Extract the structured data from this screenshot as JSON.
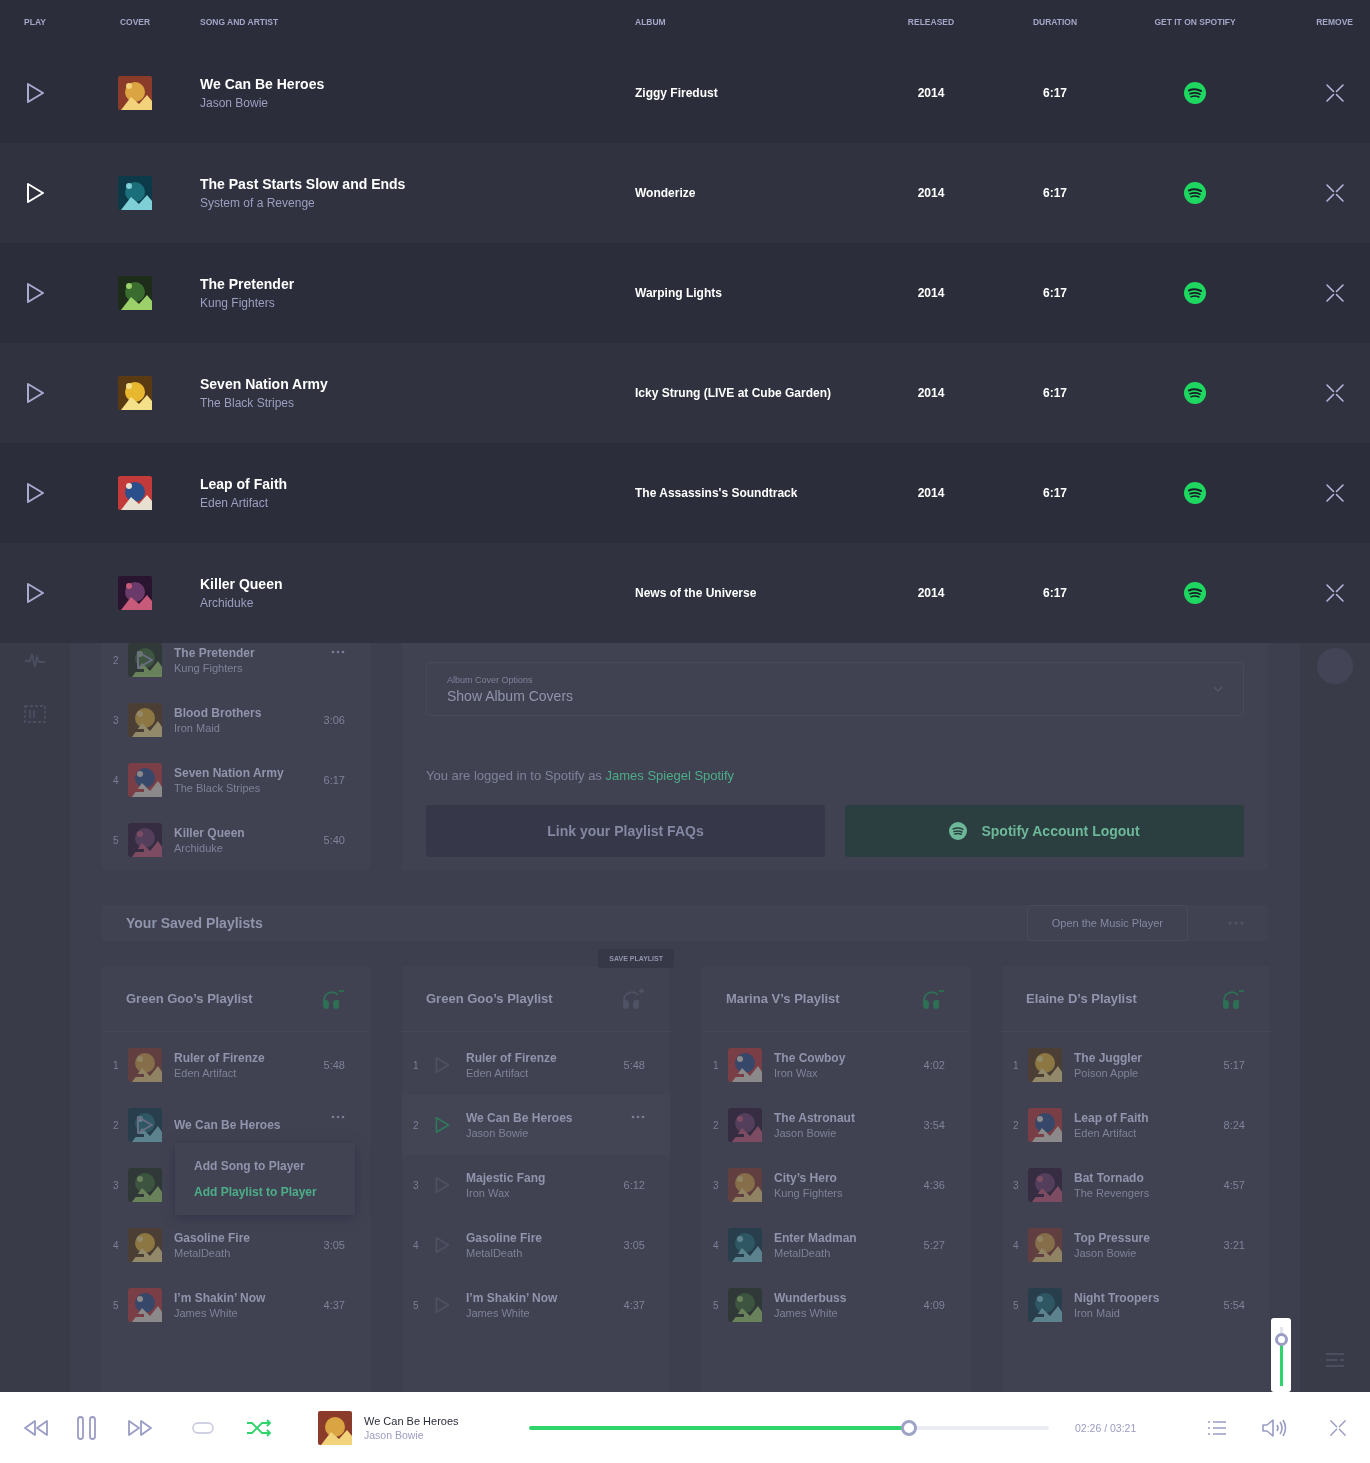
{
  "table": {
    "columns": [
      "PLAY",
      "COVER",
      "SONG AND ARTIST",
      "ALBUM",
      "RELEASED",
      "DURATION",
      "GET IT ON SPOTIFY",
      "REMOVE"
    ],
    "rows": [
      {
        "title": "We Can Be Heroes",
        "artist": "Jason Bowie",
        "album": "Ziggy Firedust",
        "released": "2014",
        "duration": "6:17",
        "hovered": false
      },
      {
        "title": "The Past Starts Slow and Ends",
        "artist": "System of a Revenge",
        "album": "Wonderize",
        "released": "2014",
        "duration": "6:17",
        "hovered": true
      },
      {
        "title": "The Pretender",
        "artist": "Kung Fighters",
        "album": "Warping Lights",
        "released": "2014",
        "duration": "6:17",
        "hovered": false
      },
      {
        "title": "Seven Nation Army",
        "artist": "The Black Stripes",
        "album": "Icky Strung (LIVE at Cube Garden)",
        "released": "2014",
        "duration": "6:17",
        "hovered": false
      },
      {
        "title": "Leap of Faith",
        "artist": "Eden Artifact",
        "album": "The Assassins's Soundtrack",
        "released": "2014",
        "duration": "6:17",
        "hovered": false
      },
      {
        "title": "Killer Queen",
        "artist": "Archiduke",
        "album": "News of the Universe",
        "released": "2014",
        "duration": "6:17",
        "hovered": false
      }
    ]
  },
  "my_playlist": {
    "rows": [
      {
        "number": "2",
        "title": "The Pretender",
        "artist": "Kung Fighters",
        "hovered": true
      },
      {
        "number": "3",
        "title": "Blood Brothers",
        "artist": "Iron Maid",
        "duration": "3:06",
        "hovered": false
      },
      {
        "number": "4",
        "title": "Seven Nation Army",
        "artist": "The Black Stripes",
        "duration": "6:17",
        "hovered": false
      },
      {
        "number": "5",
        "title": "Killer Queen",
        "artist": "Archiduke",
        "duration": "5:40",
        "hovered": false
      }
    ]
  },
  "settings": {
    "select": {
      "label": "Album Cover Options",
      "value": "Show Album Covers"
    },
    "login_text": "You are logged in to Spotify as",
    "login_link": "James Spiegel Spotify",
    "buttons": [
      {
        "label": "Link your Playlist FAQs",
        "kind": "secondary"
      },
      {
        "label": "Spotify Account Logout",
        "kind": "spotify"
      }
    ]
  },
  "saved_playlists": {
    "title": "Your Saved Playlists",
    "open_button": "Open the Music Player",
    "cards": [
      {
        "title": "Green Goo’s Playlist",
        "saved": true,
        "kind": "covers",
        "rows": [
          {
            "number": "1",
            "title": "Ruler of Firenze",
            "artist": "Eden Artifact",
            "duration": "5:48",
            "hovered": false
          },
          {
            "number": "2",
            "title": "We Can Be Heroes",
            "hovered": true,
            "menu": [
              {
                "label": "Add Song to Player",
                "selected": false
              },
              {
                "label": "Add Playlist to Player",
                "selected": true
              }
            ]
          },
          {
            "number": "3",
            "hovered": false
          },
          {
            "number": "4",
            "title": "Gasoline Fire",
            "artist": "MetalDeath",
            "duration": "3:05",
            "hovered": false
          },
          {
            "number": "5",
            "title": "I’m Shakin’ Now",
            "artist": "James White",
            "duration": "4:37",
            "hovered": false
          }
        ]
      },
      {
        "title": "Green Goo’s Playlist",
        "saved": false,
        "kind": "play",
        "tooltip": "SAVE PLAYLIST",
        "rows": [
          {
            "number": "1",
            "title": "Ruler of Firenze",
            "artist": "Eden Artifact",
            "duration": "5:48",
            "hovered": false
          },
          {
            "number": "2",
            "title": "We Can Be Heroes",
            "artist": "Jason Bowie",
            "hovered": true
          },
          {
            "number": "3",
            "title": "Majestic Fang",
            "artist": "Iron Wax",
            "duration": "6:12",
            "hovered": false
          },
          {
            "number": "4",
            "title": "Gasoline Fire",
            "artist": "MetalDeath",
            "duration": "3:05",
            "hovered": false
          },
          {
            "number": "5",
            "title": "I’m Shakin’ Now",
            "artist": "James White",
            "duration": "4:37",
            "hovered": false
          }
        ]
      },
      {
        "title": "Marina V’s Playlist",
        "saved": true,
        "kind": "covers",
        "rows": [
          {
            "number": "1",
            "title": "The Cowboy",
            "artist": "Iron Wax",
            "duration": "4:02",
            "hovered": false
          },
          {
            "number": "2",
            "title": "The Astronaut",
            "artist": "Jason Bowie",
            "duration": "3:54",
            "hovered": false
          },
          {
            "number": "3",
            "title": "City’s Hero",
            "artist": "Kung Fighters",
            "duration": "4:36",
            "hovered": false
          },
          {
            "number": "4",
            "title": "Enter Madman",
            "artist": "MetalDeath",
            "duration": "5:27",
            "hovered": false
          },
          {
            "number": "5",
            "title": "Wunderbuss",
            "artist": "James White",
            "duration": "4:09",
            "hovered": false
          }
        ]
      },
      {
        "title": "Elaine D’s Playlist",
        "saved": true,
        "kind": "covers",
        "rows": [
          {
            "number": "1",
            "title": "The Juggler",
            "artist": "Poison Apple",
            "duration": "5:17",
            "hovered": false
          },
          {
            "number": "2",
            "title": "Leap of Faith",
            "artist": "Eden Artifact",
            "duration": "8:24",
            "hovered": false
          },
          {
            "number": "3",
            "title": "Bat Tornado",
            "artist": "The Revengers",
            "duration": "4:57",
            "hovered": false
          },
          {
            "number": "4",
            "title": "Top Pressure",
            "artist": "Jason Bowie",
            "duration": "3:21",
            "hovered": false
          },
          {
            "number": "5",
            "title": "Night Troopers",
            "artist": "Iron Maid",
            "duration": "5:54",
            "hovered": false
          }
        ]
      }
    ]
  },
  "player": {
    "title": "We Can Be Heroes",
    "artist": "Jason Bowie",
    "level": 0.73,
    "time": "02:26 / 03:21",
    "repeat": false,
    "shuffle": true,
    "volume": {
      "level": 0.8
    }
  }
}
